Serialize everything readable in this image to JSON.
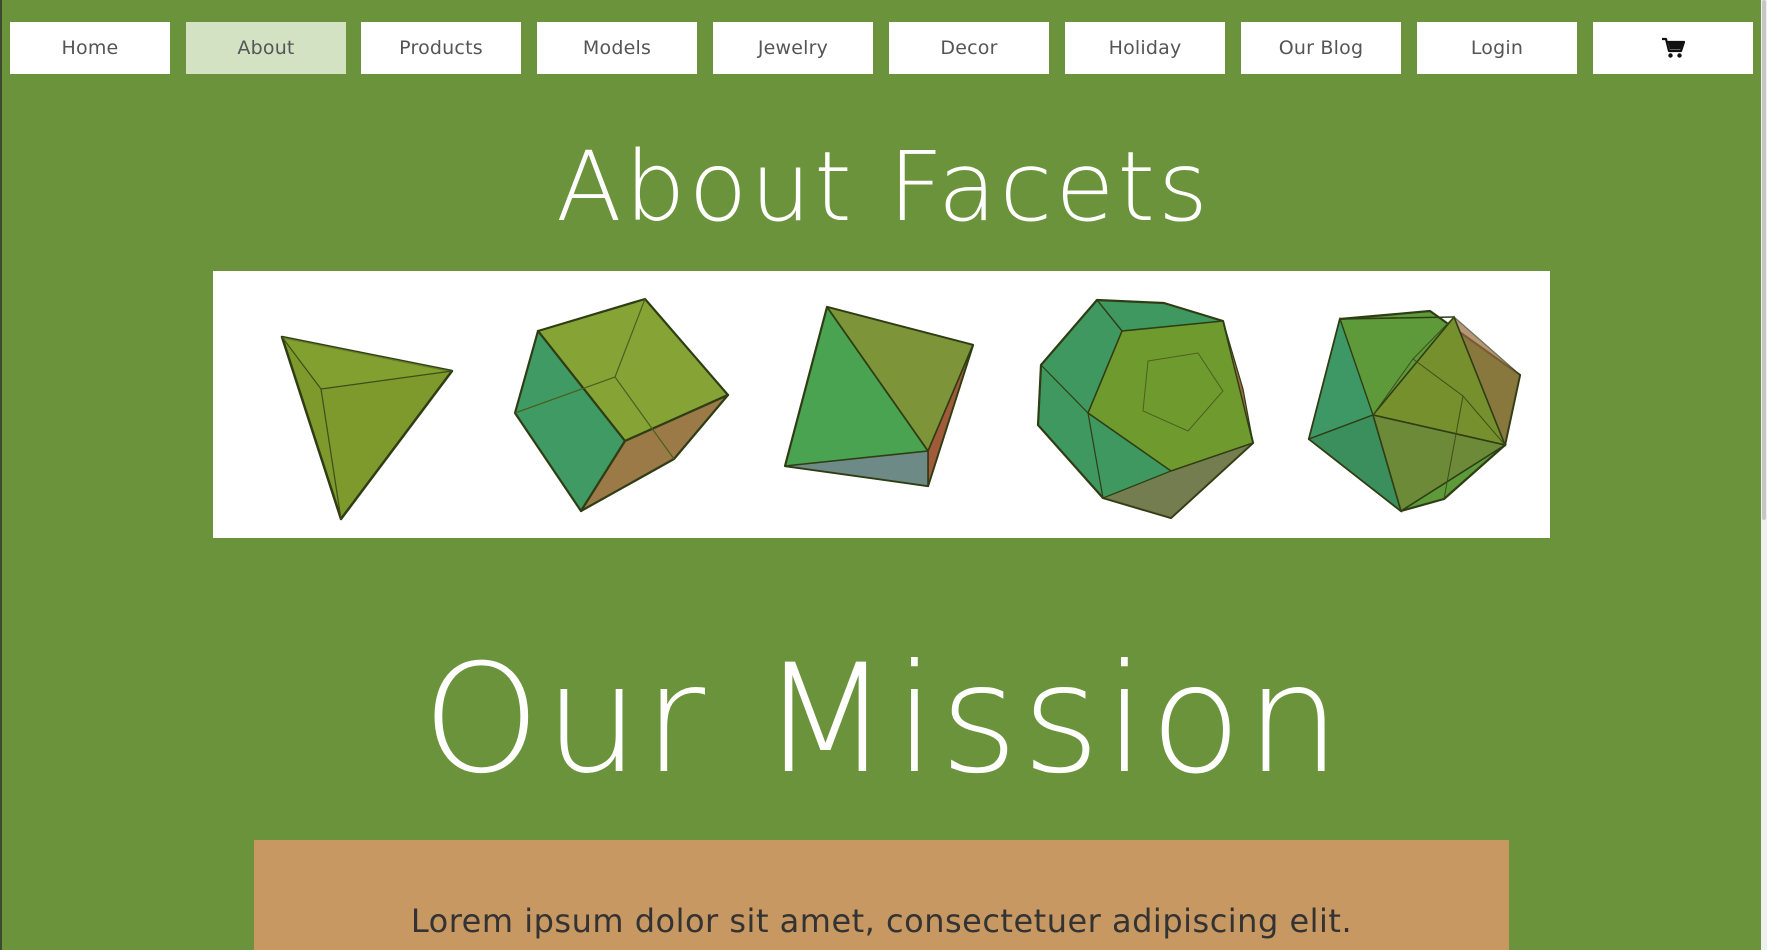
{
  "nav": {
    "items": [
      {
        "label": "Home"
      },
      {
        "label": "About"
      },
      {
        "label": "Products"
      },
      {
        "label": "Models"
      },
      {
        "label": "Jewelry"
      },
      {
        "label": "Decor"
      },
      {
        "label": "Holiday"
      },
      {
        "label": "Our Blog"
      },
      {
        "label": "Login"
      }
    ],
    "active_item": "About",
    "cart_icon": "shopping-cart-icon"
  },
  "hero": {
    "title": "About Facets",
    "image_content": [
      "tetrahedron",
      "cube",
      "octahedron",
      "dodecahedron",
      "icosahedron"
    ]
  },
  "mission": {
    "title": "Our Mission",
    "text": "Lorem ipsum dolor sit amet, consectetuer adipiscing elit."
  },
  "colors": {
    "page_background": "#6b933b",
    "nav_button": "#ffffff",
    "nav_active": "#d4e2c4",
    "mission_box": "#c89862"
  }
}
